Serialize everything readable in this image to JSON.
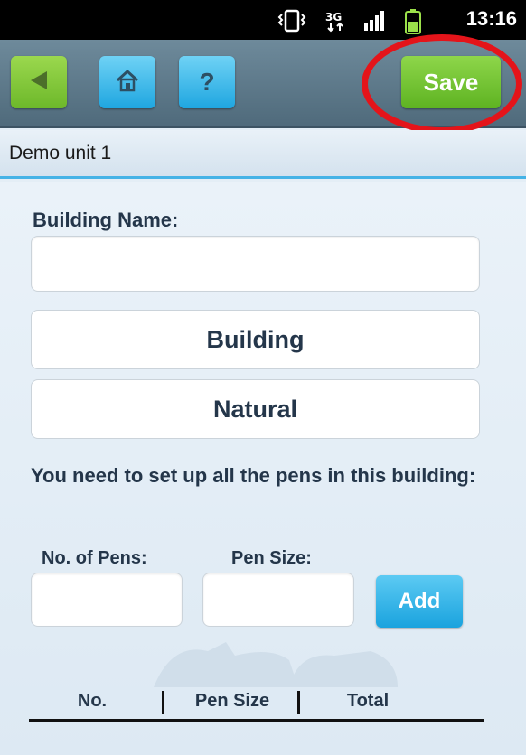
{
  "status_bar": {
    "time": "13:16",
    "icons": [
      "vibrate-icon",
      "3g-data-icon",
      "signal-bars-icon",
      "battery-icon"
    ]
  },
  "toolbar": {
    "back_icon": "back-arrow-icon",
    "home_icon": "home-icon",
    "help_label": "?",
    "save_label": "Save",
    "colors": {
      "green": "#6db82a",
      "blue": "#1fa6e0",
      "highlight": "#e4141a"
    }
  },
  "page": {
    "title": "Demo unit 1"
  },
  "form": {
    "building_name_label": "Building Name:",
    "building_name_value": "",
    "type_selector": "Building",
    "ventilation_selector": "Natural",
    "pens_instruction": "You need to set up all the pens in this building:",
    "num_pens_label": "No. of Pens:",
    "num_pens_value": "",
    "pen_size_label": "Pen Size:",
    "pen_size_value": "",
    "add_label": "Add"
  },
  "pens_table": {
    "columns": [
      "No.",
      "Pen Size",
      "Total"
    ],
    "rows": []
  }
}
